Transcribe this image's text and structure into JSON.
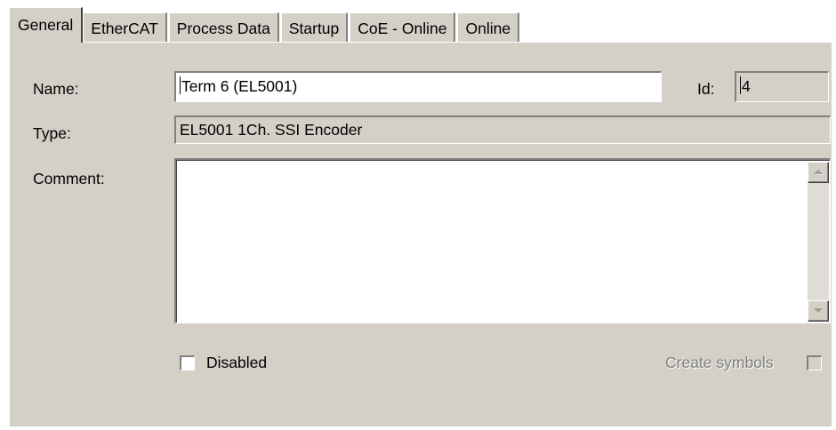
{
  "tabs": [
    {
      "label": "General",
      "active": true
    },
    {
      "label": "EtherCAT",
      "active": false
    },
    {
      "label": "Process Data",
      "active": false
    },
    {
      "label": "Startup",
      "active": false
    },
    {
      "label": "CoE - Online",
      "active": false
    },
    {
      "label": "Online",
      "active": false
    }
  ],
  "general": {
    "name_label": "Name:",
    "name_value": "Term 6 (EL5001)",
    "id_label": "Id:",
    "id_value": "4",
    "type_label": "Type:",
    "type_value": "EL5001 1Ch. SSI Encoder",
    "comment_label": "Comment:",
    "comment_value": "",
    "disabled_label": "Disabled",
    "disabled_checked": false,
    "create_symbols_label": "Create symbols",
    "create_symbols_checked": false,
    "create_symbols_enabled": false
  },
  "icons": {
    "scroll_up": "arrow-up-icon",
    "scroll_down": "arrow-down-icon"
  },
  "colors": {
    "dialog_face": "#d4d0c8",
    "shadow": "#808080",
    "highlight": "#ffffff",
    "disabled_text": "#808080"
  }
}
